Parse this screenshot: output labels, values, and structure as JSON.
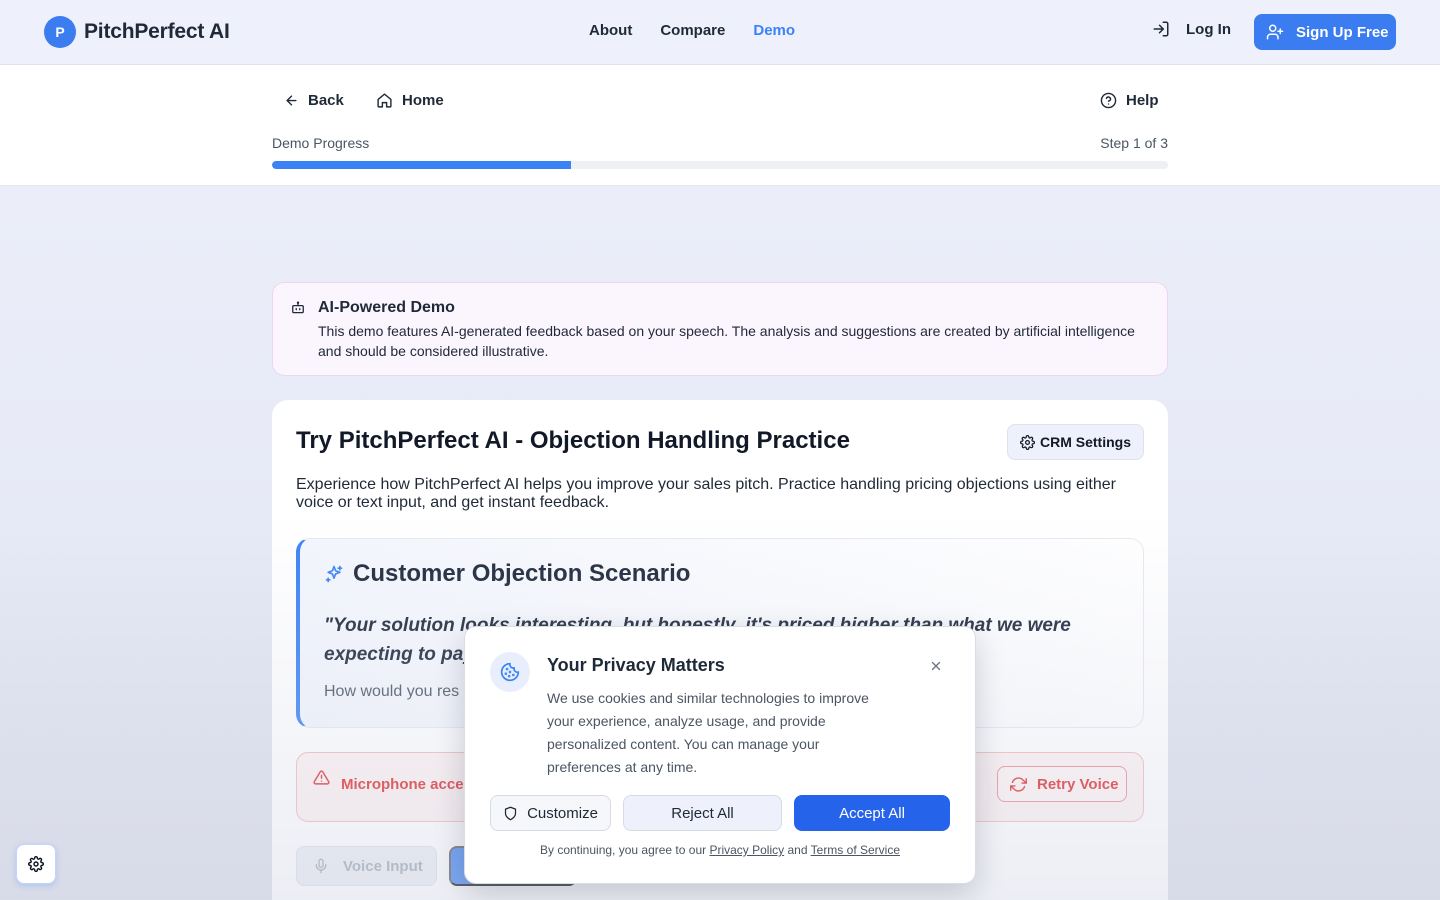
{
  "header": {
    "brand_initial": "P",
    "brand_name": "PitchPerfect AI",
    "nav": [
      {
        "label": "About",
        "active": false
      },
      {
        "label": "Compare",
        "active": false
      },
      {
        "label": "Demo",
        "active": true
      }
    ],
    "login_label": "Log In",
    "signup_label": "Sign Up Free"
  },
  "subheader": {
    "back_label": "Back",
    "home_label": "Home",
    "help_label": "Help",
    "progress_label": "Demo Progress",
    "step_label": "Step 1 of 3",
    "progress_fraction": 0.3333
  },
  "ai_notice": {
    "title": "AI-Powered Demo",
    "body": "This demo features AI-generated feedback based on your speech. The analysis and suggestions are created by artificial intelligence and should be considered illustrative."
  },
  "card": {
    "title": "Try PitchPerfect AI - Objection Handling Practice",
    "crm_label": "CRM Settings",
    "description": "Experience how PitchPerfect AI helps you improve your sales pitch. Practice handling pricing objections using either voice or text input, and get instant feedback.",
    "scenario_title": "Customer Objection Scenario",
    "scenario_quote": "\"Your solution looks interesting, but honestly, it's priced higher than what we were expecting to pay",
    "scenario_prompt": "How would you res",
    "mic_alert": "Microphone acces",
    "retry_label": "Retry Voice",
    "voice_input_label": "Voice Input"
  },
  "privacy_modal": {
    "title": "Your Privacy Matters",
    "body": "We use cookies and similar technologies to improve your experience, analyze usage, and provide personalized content. You can manage your preferences at any time.",
    "customize_label": "Customize",
    "reject_label": "Reject All",
    "accept_label": "Accept All",
    "footer_prefix": "By continuing, you agree to our",
    "privacy_link": "Privacy Policy",
    "footer_and": "and",
    "terms_link": "Terms of Service"
  },
  "colors": {
    "accent": "#3b82f6",
    "danger": "#dc2626",
    "ai_notice_bg": "#fbf5fd"
  },
  "icons": [
    "login-icon",
    "user-plus-icon",
    "arrow-left-icon",
    "home-icon",
    "help-circle-icon",
    "bot-icon",
    "gear-icon",
    "sparkles-icon",
    "alert-triangle-icon",
    "refresh-icon",
    "mic-icon",
    "cookie-icon",
    "close-icon",
    "shield-icon"
  ]
}
